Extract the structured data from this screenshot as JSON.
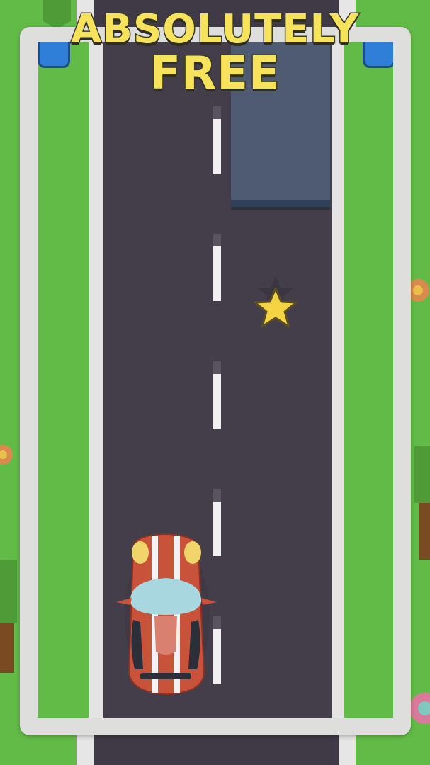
{
  "title": {
    "line1": "ABSOLUTELY",
    "line2": "FREE"
  },
  "colors": {
    "title_fill": "#f6e25b",
    "grass": "#63bb47",
    "road": "#443d4a",
    "curb": "#e4e4e4",
    "lane_dash": "#f1f1f1",
    "truck": "#4f5b72",
    "player_car": "#c9523a",
    "star": "#f4d442"
  },
  "icons": {
    "collectible": "star-icon",
    "roadside_signs": "sign-icon"
  }
}
